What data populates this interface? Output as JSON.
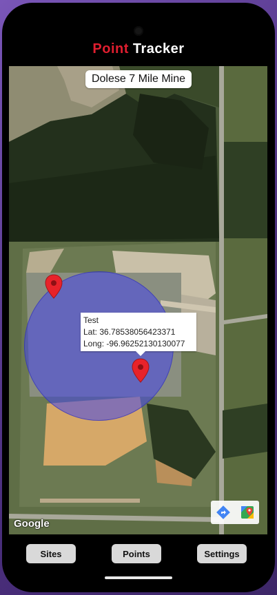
{
  "app": {
    "title_part1": "Point",
    "title_part2": "Tracker"
  },
  "map": {
    "site_name": "Dolese 7 Mile Mine",
    "marker_info": {
      "name": "Test",
      "lat": "Lat: 36.78538056423371",
      "long": "Long: -96.96252130130077"
    },
    "google_logo": "Google",
    "icons": {
      "directions": "directions-icon",
      "maps": "google-maps-icon",
      "marker": "map-marker-icon"
    }
  },
  "nav": {
    "sites": "Sites",
    "points": "Points",
    "settings": "Settings"
  },
  "colors": {
    "title_accent": "#e01e2f",
    "geofence": "#4646eb",
    "marker": "#e8232a"
  }
}
